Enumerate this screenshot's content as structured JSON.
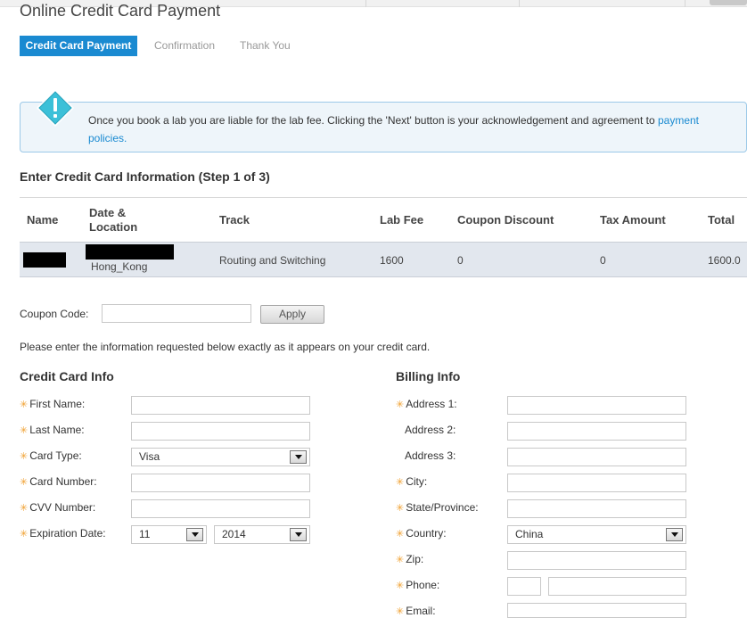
{
  "page": {
    "title": "Online Credit Card Payment"
  },
  "steps": [
    {
      "label": "Credit Card Payment",
      "active": true
    },
    {
      "label": "Confirmation",
      "active": false
    },
    {
      "label": "Thank You",
      "active": false
    }
  ],
  "alert": {
    "text": "Once you book a lab you are liable for the lab fee. Clicking the 'Next' button is your acknowledgement and agreement to ",
    "link": "payment policies."
  },
  "section": {
    "title": "Enter Credit Card Information (Step 1 of 3)"
  },
  "table": {
    "headers": [
      "Name",
      "Date & Location",
      "Track",
      "Lab Fee",
      "Coupon Discount",
      "Tax Amount",
      "Total"
    ],
    "row": {
      "location": "Hong_Kong",
      "track": "Routing and Switching",
      "lab_fee": "1600",
      "coupon_discount": "0",
      "tax_amount": "0",
      "total": "1600.0"
    }
  },
  "coupon": {
    "label": "Coupon Code:",
    "value": "",
    "apply_label": "Apply"
  },
  "instructions": "Please enter the information requested below exactly as it appears on your credit card.",
  "credit_card_info": {
    "title": "Credit Card Info",
    "first_name_label": "First Name:",
    "last_name_label": "Last Name:",
    "card_type_label": "Card Type:",
    "card_type_value": "Visa",
    "card_number_label": "Card Number:",
    "cvv_label": "CVV Number:",
    "expiration_label": "Expiration Date:",
    "exp_month_value": "11",
    "exp_year_value": "2014"
  },
  "billing_info": {
    "title": "Billing Info",
    "address1_label": "Address 1:",
    "address2_label": "Address 2:",
    "address3_label": "Address 3:",
    "city_label": "City:",
    "state_label": "State/Province:",
    "country_label": "Country:",
    "country_value": "China",
    "zip_label": "Zip:",
    "phone_label": "Phone:",
    "email_label": "Email:"
  },
  "colors": {
    "accent": "#1a8ad1",
    "required": "#f0a030",
    "row_bg": "#e2e7ee",
    "alert_bg": "#eef5fa"
  },
  "icons": {
    "alert": "exclamation-diamond-icon",
    "required": "asterisk-icon",
    "dropdown": "dropdown-arrow-icon"
  }
}
